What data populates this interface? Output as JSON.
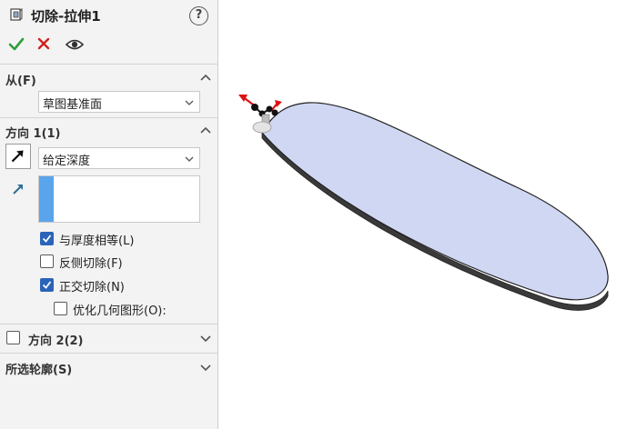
{
  "panel": {
    "title": "切除-拉伸1",
    "help_symbol": "?",
    "actions": {
      "ok_icon": "check-icon",
      "cancel_icon": "close-icon",
      "preview_icon": "eye-icon"
    }
  },
  "from": {
    "title": "从(F)",
    "value": "草图基准面"
  },
  "direction1": {
    "title": "方向 1(1)",
    "end_condition": "给定深度",
    "depth_value": "",
    "options": [
      {
        "label": "与厚度相等(L)",
        "checked": true
      },
      {
        "label": "反侧切除(F)",
        "checked": false
      },
      {
        "label": "正交切除(N)",
        "checked": true
      },
      {
        "label": "优化几何图形(O):",
        "checked": false
      }
    ]
  },
  "direction2": {
    "title": "方向 2(2)",
    "checked": false
  },
  "selected_contours": {
    "title": "所选轮廓(S)"
  },
  "colors": {
    "accent": "#2b63b8",
    "depth_bar": "#5aa4ec",
    "body_fill": "#d0d7f2",
    "ok": "#2e9e3a",
    "cancel": "#d02020"
  }
}
